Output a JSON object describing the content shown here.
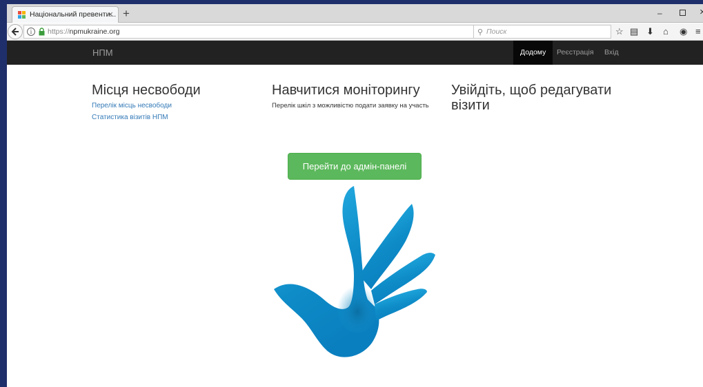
{
  "browser": {
    "tab_title": "Національний превенти...",
    "url_protocol": "https://",
    "url_host": "npmukraine.org",
    "search_placeholder": "Поиск"
  },
  "site": {
    "brand": "НПМ",
    "nav": [
      {
        "label": "Додому",
        "active": true
      },
      {
        "label": "Реєстрація",
        "active": false
      },
      {
        "label": "Вхід",
        "active": false
      }
    ]
  },
  "content": {
    "col1": {
      "title": "Місця несвободи",
      "links": [
        "Перелік місць несвободи",
        "Статистика візитів НПМ"
      ]
    },
    "col2": {
      "title": "Навчитися моніторингу",
      "text": "Перелік шкіл з можливістю подати заявку на участь"
    },
    "col3": {
      "title": "Увійдіть, щоб редагувати візити"
    },
    "admin_button": "Перейти до адмін-панелі"
  },
  "colors": {
    "header_bg": "#222222",
    "admin_button": "#5cb85c",
    "link": "#337ab7",
    "logo_light": "#29b6e8",
    "logo_dark": "#0a6fa3"
  }
}
